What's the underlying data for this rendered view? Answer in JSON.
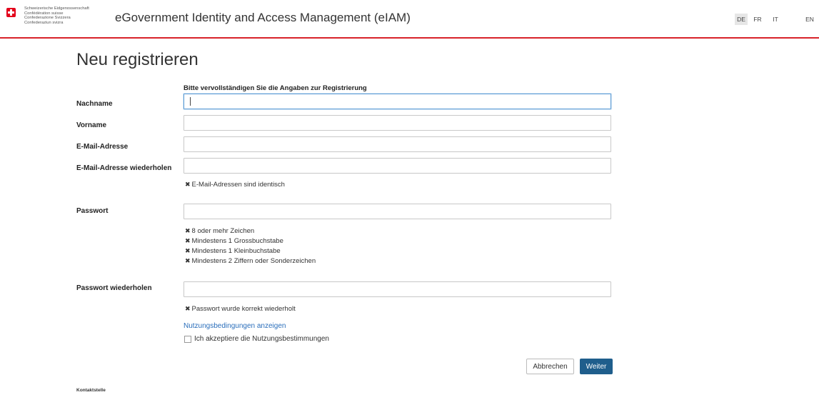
{
  "header": {
    "confederation": [
      "Schweizerische Eidgenossenschaft",
      "Confédération suisse",
      "Confederazione Svizzera",
      "Confederaziun svizra"
    ],
    "app_title": "eGovernment Identity and Access Management (eIAM)",
    "languages": [
      "DE",
      "FR",
      "IT",
      "EN"
    ],
    "active_language": "DE",
    "brand_color": "#e3001b",
    "accent_line_color": "#d8232a"
  },
  "page": {
    "title": "Neu registrieren",
    "intro": "Bitte vervollständigen Sie die Angaben zur Registrierung"
  },
  "form": {
    "lastname_label": "Nachname",
    "lastname_value": "",
    "firstname_label": "Vorname",
    "firstname_value": "",
    "email_label": "E-Mail-Adresse",
    "email_value": "",
    "email_repeat_label": "E-Mail-Adresse wiederholen",
    "email_repeat_value": "",
    "email_match": "E-Mail-Adressen sind identisch",
    "password_label": "Passwort",
    "password_value": "",
    "password_rules": [
      "8 oder mehr Zeichen",
      "Mindestens 1 Grossbuchstabe",
      "Mindestens 1 Kleinbuchstabe",
      "Mindestens 2 Ziffern oder Sonderzeichen"
    ],
    "password_repeat_label": "Passwort wiederholen",
    "password_repeat_value": "",
    "password_match": "Passwort wurde korrekt wiederholt",
    "rule_status_icon": "x-mark-icon",
    "terms_link": "Nutzungsbedingungen anzeigen",
    "terms_checkbox_label": "Ich akzeptiere die Nutzungsbestimmungen",
    "terms_checked": false
  },
  "actions": {
    "cancel_label": "Abbrechen",
    "next_label": "Weiter",
    "primary_color": "#1f5e8c"
  },
  "footer": {
    "contact": "Kontaktstelle"
  }
}
